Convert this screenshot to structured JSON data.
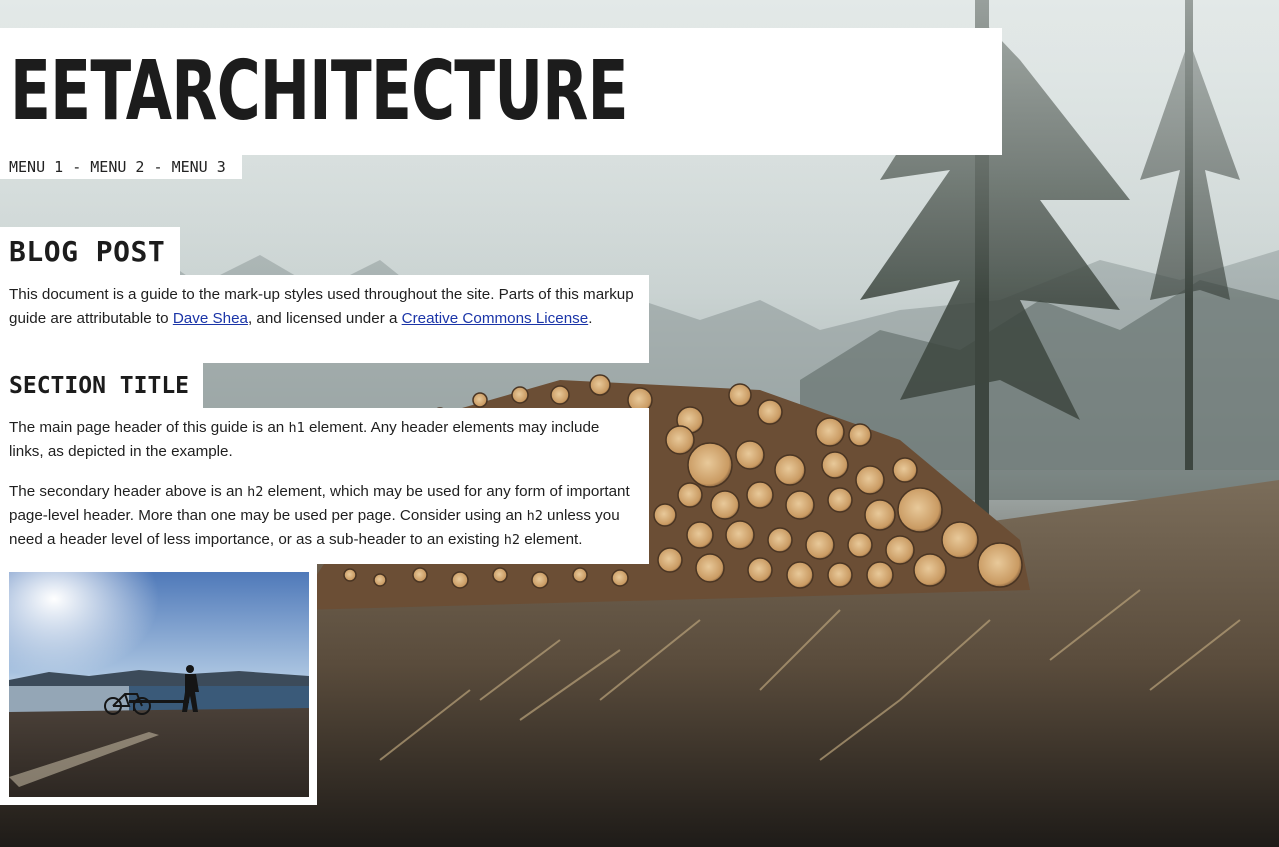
{
  "site": {
    "title": "EETARCHITECTURE"
  },
  "nav": {
    "items": [
      "MENU 1",
      "MENU 2",
      "MENU 3"
    ],
    "separator": " - "
  },
  "post": {
    "title": "BLOG POST",
    "intro": {
      "text_before": "This document is a guide to the mark-up styles used throughout the site. Parts of this markup guide are attributable to ",
      "link1": "Dave Shea",
      "text_middle": ", and licensed under a ",
      "link2": "Creative Commons License",
      "text_after": "."
    }
  },
  "section": {
    "title": "SECTION TITLE",
    "p1": {
      "a": "The main page header of this guide is an ",
      "code": "h1",
      "b": " element. Any header elements may include links, as depicted in the example."
    },
    "p2": {
      "a": "The secondary header above is an ",
      "code1": "h2",
      "b": " element, which may be used for any form of important page-level header. More than one may be used per page. Consider using an ",
      "code2": "h2",
      "c": " unless you need a header level of less importance, or as a sub-header to an existing ",
      "code3": "h2",
      "d": " element."
    }
  },
  "colors": {
    "link": "#1b35a8",
    "block_bg": "#ffffff",
    "text": "#1f1f1f"
  }
}
